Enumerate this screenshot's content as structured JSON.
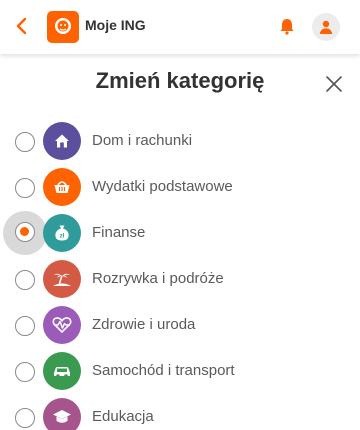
{
  "header": {
    "app_title": "Moje ING",
    "accent_color": "#ff6200",
    "back_icon": "chevron-left-icon",
    "notification_icon": "bell-icon",
    "profile_icon": "user-icon"
  },
  "sheet": {
    "title": "Zmień kategorię",
    "close_icon": "close-icon"
  },
  "categories": [
    {
      "label": "Dom i rachunki",
      "icon": "house-icon",
      "color": "#5c4f9e",
      "selected": false
    },
    {
      "label": "Wydatki podstawowe",
      "icon": "basket-icon",
      "color": "#ff6200",
      "selected": false
    },
    {
      "label": "Finanse",
      "icon": "money-bag-icon",
      "color": "#2f9b9b",
      "selected": true
    },
    {
      "label": "Rozrywka i podróże",
      "icon": "palm-island-icon",
      "color": "#d35b45",
      "selected": false
    },
    {
      "label": "Zdrowie i uroda",
      "icon": "heartbeat-icon",
      "color": "#9b5bb8",
      "selected": false
    },
    {
      "label": "Samochód i transport",
      "icon": "car-icon",
      "color": "#3a9a4f",
      "selected": false
    },
    {
      "label": "Edukacja",
      "icon": "graduation-cap-icon",
      "color": "#a5558c",
      "selected": false
    }
  ]
}
